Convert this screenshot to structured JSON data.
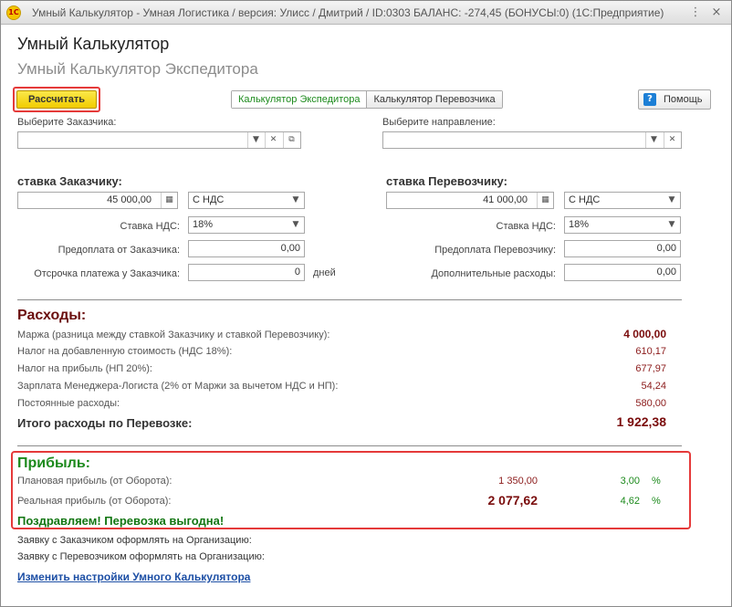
{
  "window": {
    "logo": "1С",
    "title": "Умный Калькулятор - Умная Логистика / версия: Улисс / Дмитрий / ID:0303 БАЛАНС: -274,45 (БОНУСЫ:0)  (1С:Предприятие)",
    "minimize": "⋮",
    "close": "×"
  },
  "header": {
    "title": "Умный Калькулятор",
    "subtitle": "Умный Калькулятор Экспедитора"
  },
  "toolbar": {
    "calculate": "Рассчитать",
    "tabs": [
      "Калькулятор Экспедитора",
      "Калькулятор Перевозчика"
    ],
    "help": "Помощь",
    "help_icon": "?"
  },
  "customer_select": {
    "label": "Выберите Заказчика:",
    "value": ""
  },
  "direction_select": {
    "label": "Выберите направление:",
    "value": ""
  },
  "left": {
    "heading": "ставка Заказчику:",
    "rate": "45 000,00",
    "vat_mode": "С НДС",
    "vat_label": "Ставка НДС:",
    "vat_value": "18%",
    "prepay_label": "Предоплата от Заказчика:",
    "prepay_value": "0,00",
    "delay_label": "Отсрочка платежа у Заказчика:",
    "delay_value": "0",
    "delay_unit": "дней"
  },
  "right": {
    "heading": "ставка Перевозчику:",
    "rate": "41 000,00",
    "vat_mode": "С НДС",
    "vat_label": "Ставка НДС:",
    "vat_value": "18%",
    "prepay_label": "Предоплата Перевозчику:",
    "prepay_value": "0,00",
    "extra_label": "Дополнительные расходы:",
    "extra_value": "0,00"
  },
  "expenses": {
    "title": "Расходы:",
    "rows": [
      {
        "label": "Маржа (разница между ставкой Заказчику и ставкой Перевозчику):",
        "value": "4 000,00"
      },
      {
        "label": "Налог на добавленную стоимость (НДС 18%):",
        "value": "610,17"
      },
      {
        "label": "Налог на прибыль (НП 20%):",
        "value": "677,97"
      },
      {
        "label": "Зарплата Менеджера-Логиста (2% от Маржи за вычетом НДС и НП):",
        "value": "54,24"
      },
      {
        "label": "Постоянные расходы:",
        "value": "580,00"
      }
    ],
    "total_label": "Итого расходы по Перевозке:",
    "total_value": "1 922,38"
  },
  "profit": {
    "title": "Прибыль:",
    "planned_label": "Плановая прибыль (от Оборота):",
    "planned_value": "1 350,00",
    "planned_pct": "3,00",
    "real_label": "Реальная прибыль (от Оборота):",
    "real_value": "2 077,62",
    "real_pct": "4,62",
    "pct_sign": "%",
    "congrats": "Поздравляем! Перевозка выгодна!"
  },
  "footer": {
    "customer_org": "Заявку с Заказчиком оформлять на Организацию:",
    "carrier_org": "Заявку с Перевозчиком оформлять на Организацию:",
    "settings_link": "Изменить настройки Умного Калькулятора"
  }
}
